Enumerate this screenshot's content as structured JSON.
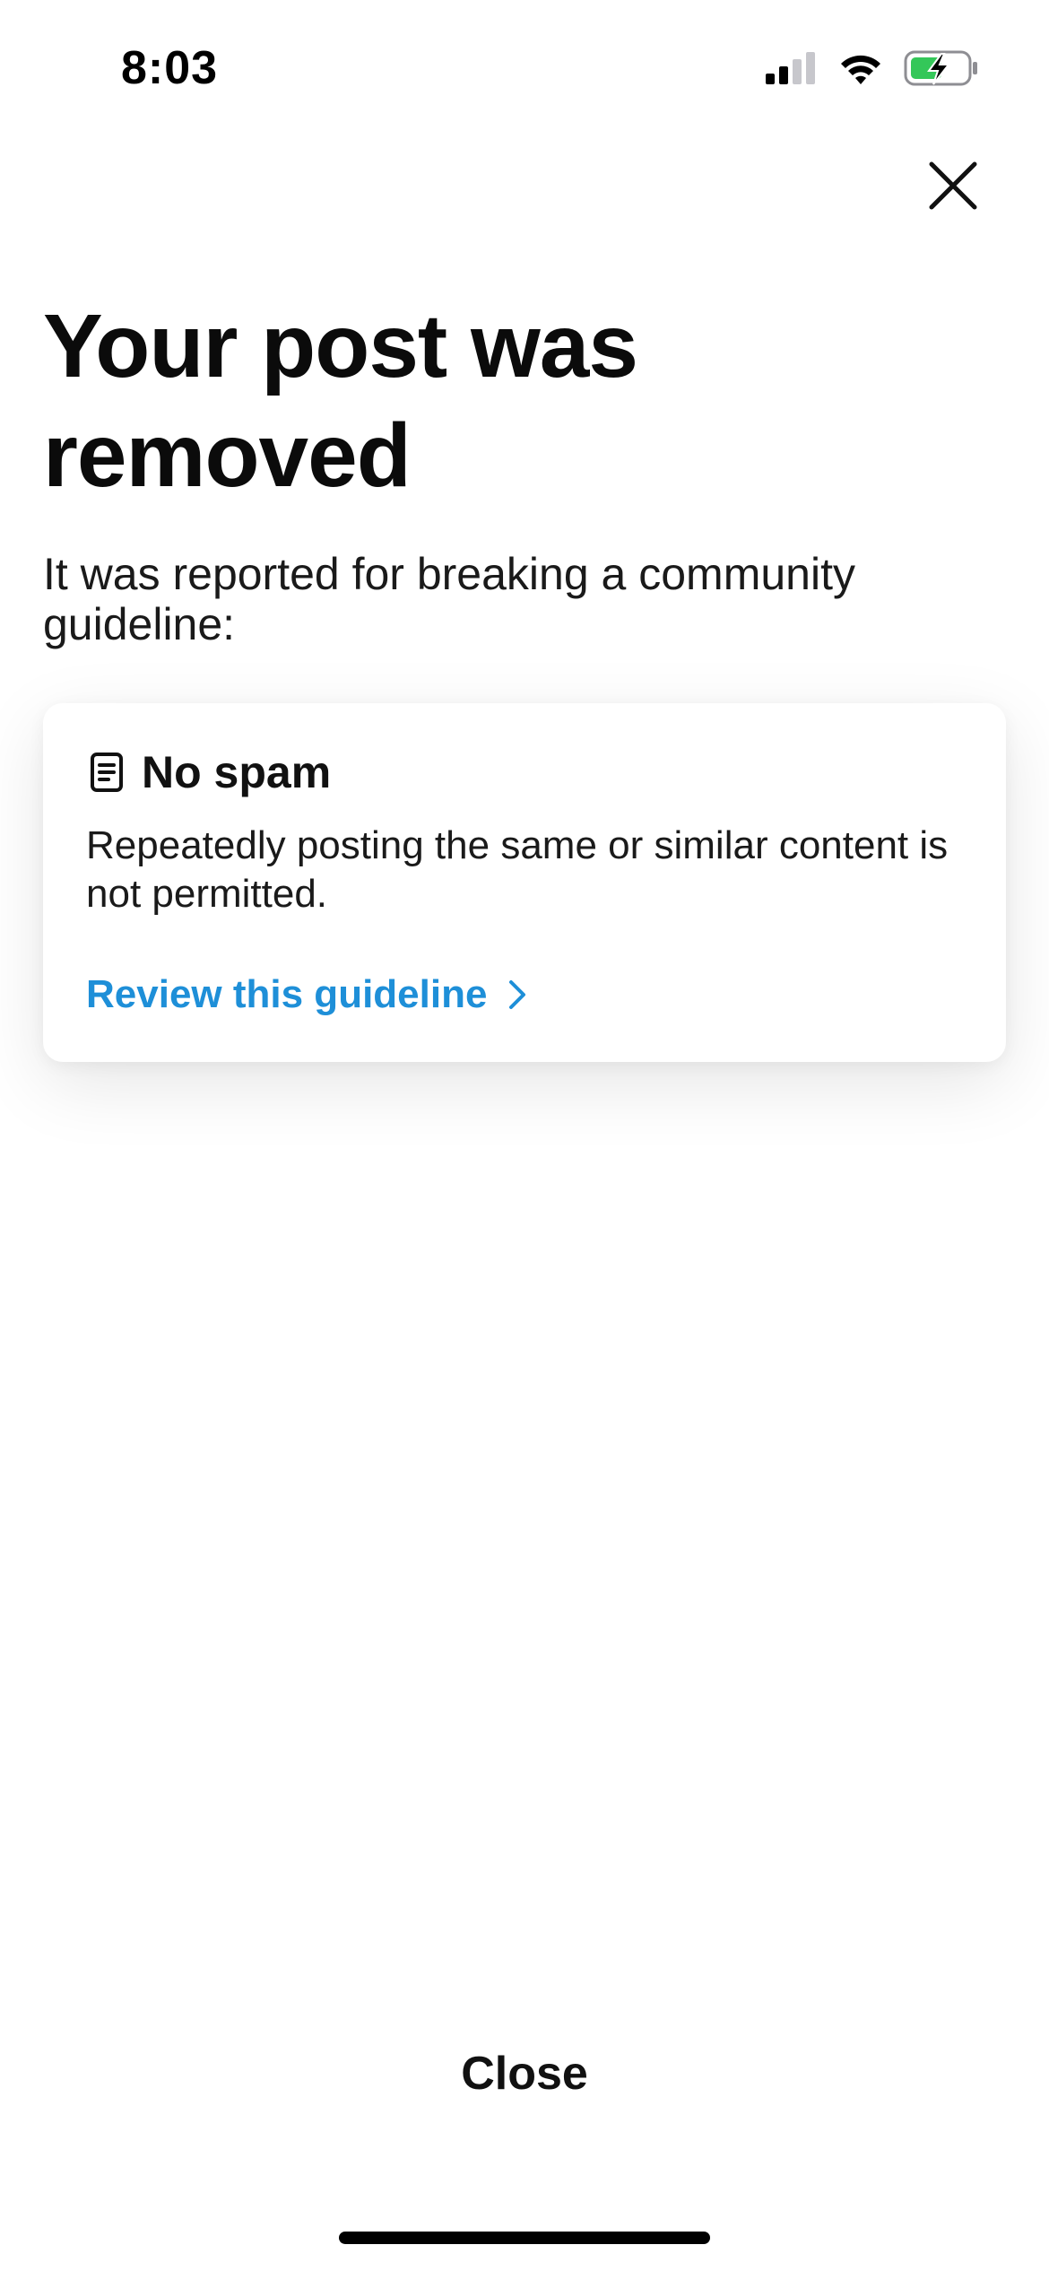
{
  "status_bar": {
    "time": "8:03",
    "icons": [
      "cellular-signal-icon",
      "wifi-icon",
      "battery-charging-icon"
    ]
  },
  "header": {
    "close_icon": "close-icon"
  },
  "main": {
    "title": "Your post was removed",
    "subtitle": "It was reported for breaking a community guideline:"
  },
  "guideline_card": {
    "icon": "document-icon",
    "title": "No spam",
    "description": "Repeatedly posting the same or similar content is not permitted.",
    "link_label": "Review this guideline",
    "link_icon": "chevron-right-icon"
  },
  "footer": {
    "close_label": "Close"
  },
  "colors": {
    "link": "#1e8fd8",
    "battery_fill": "#34c759",
    "text": "#111111"
  }
}
